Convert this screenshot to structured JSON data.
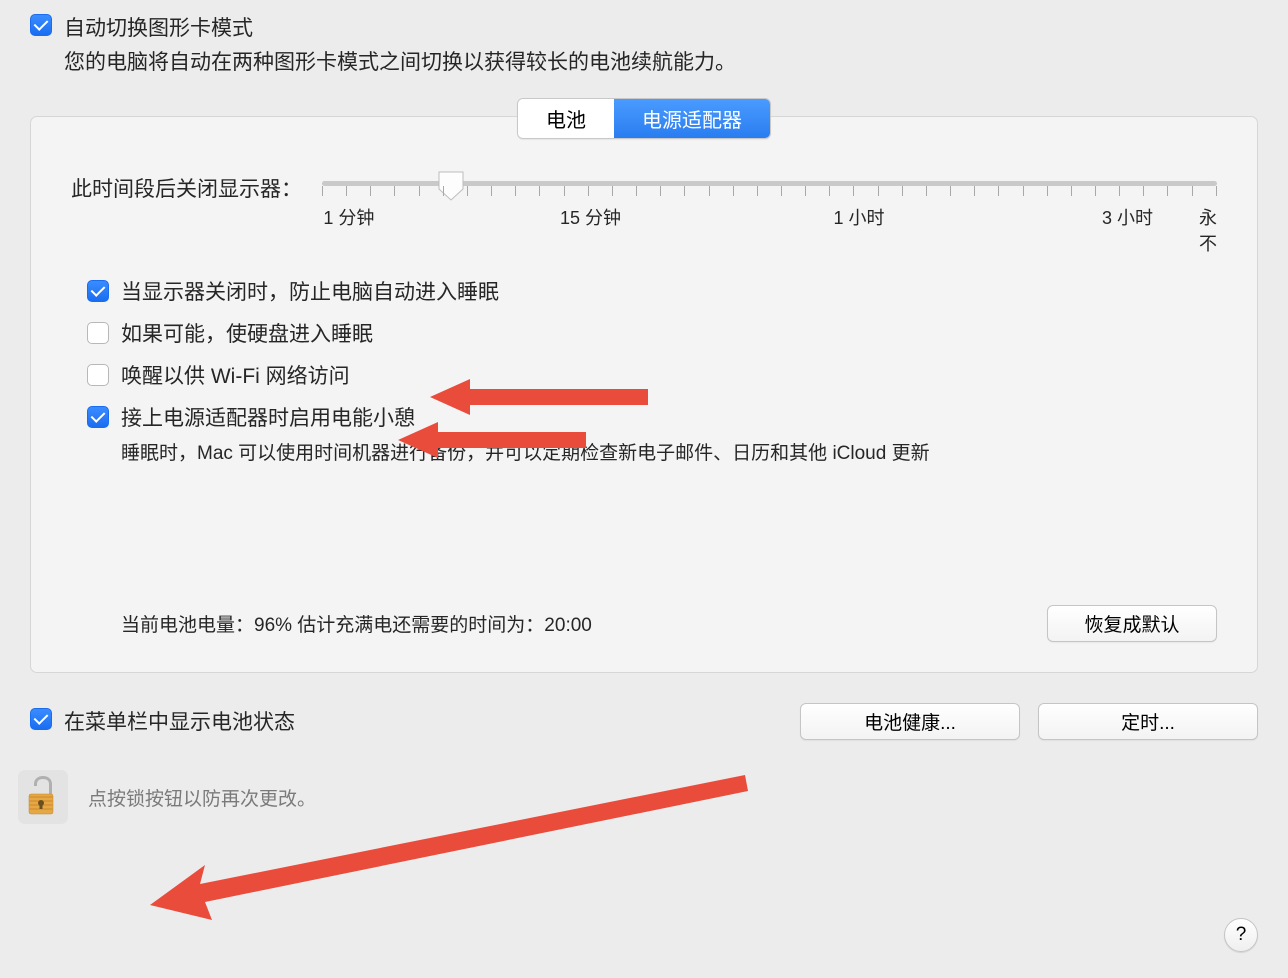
{
  "top_checkbox": {
    "label": "自动切换图形卡模式",
    "checked": true,
    "subtext": "您的电脑将自动在两种图形卡模式之间切换以获得较长的电池续航能力。"
  },
  "tabs": {
    "battery": "电池",
    "adapter": "电源适配器",
    "active": "adapter"
  },
  "slider": {
    "label": "此时间段后关闭显示器：",
    "ticks": {
      "t1": "1 分钟",
      "t15": "15 分钟",
      "t1h": "1 小时",
      "t3h": "3 小时",
      "never": "永不"
    }
  },
  "options": {
    "prevent_sleep": {
      "label": "当显示器关闭时，防止电脑自动进入睡眠",
      "checked": true
    },
    "hdd_sleep": {
      "label": "如果可能，使硬盘进入睡眠",
      "checked": false
    },
    "wake_wifi": {
      "label": "唤醒以供 Wi-Fi 网络访问",
      "checked": false
    },
    "power_nap": {
      "label": "接上电源适配器时启用电能小憩",
      "checked": true,
      "subtext": "睡眠时，Mac 可以使用时间机器进行备份，并可以定期检查新电子邮件、日历和其他 iCloud 更新"
    }
  },
  "battery_status": "当前电池电量：96% 估计充满电还需要的时间为：20:00",
  "buttons": {
    "restore": "恢复成默认",
    "health": "电池健康...",
    "schedule": "定时..."
  },
  "menubar_checkbox": {
    "label": "在菜单栏中显示电池状态",
    "checked": true
  },
  "lock_text": "点按锁按钮以防再次更改。",
  "help": "?"
}
